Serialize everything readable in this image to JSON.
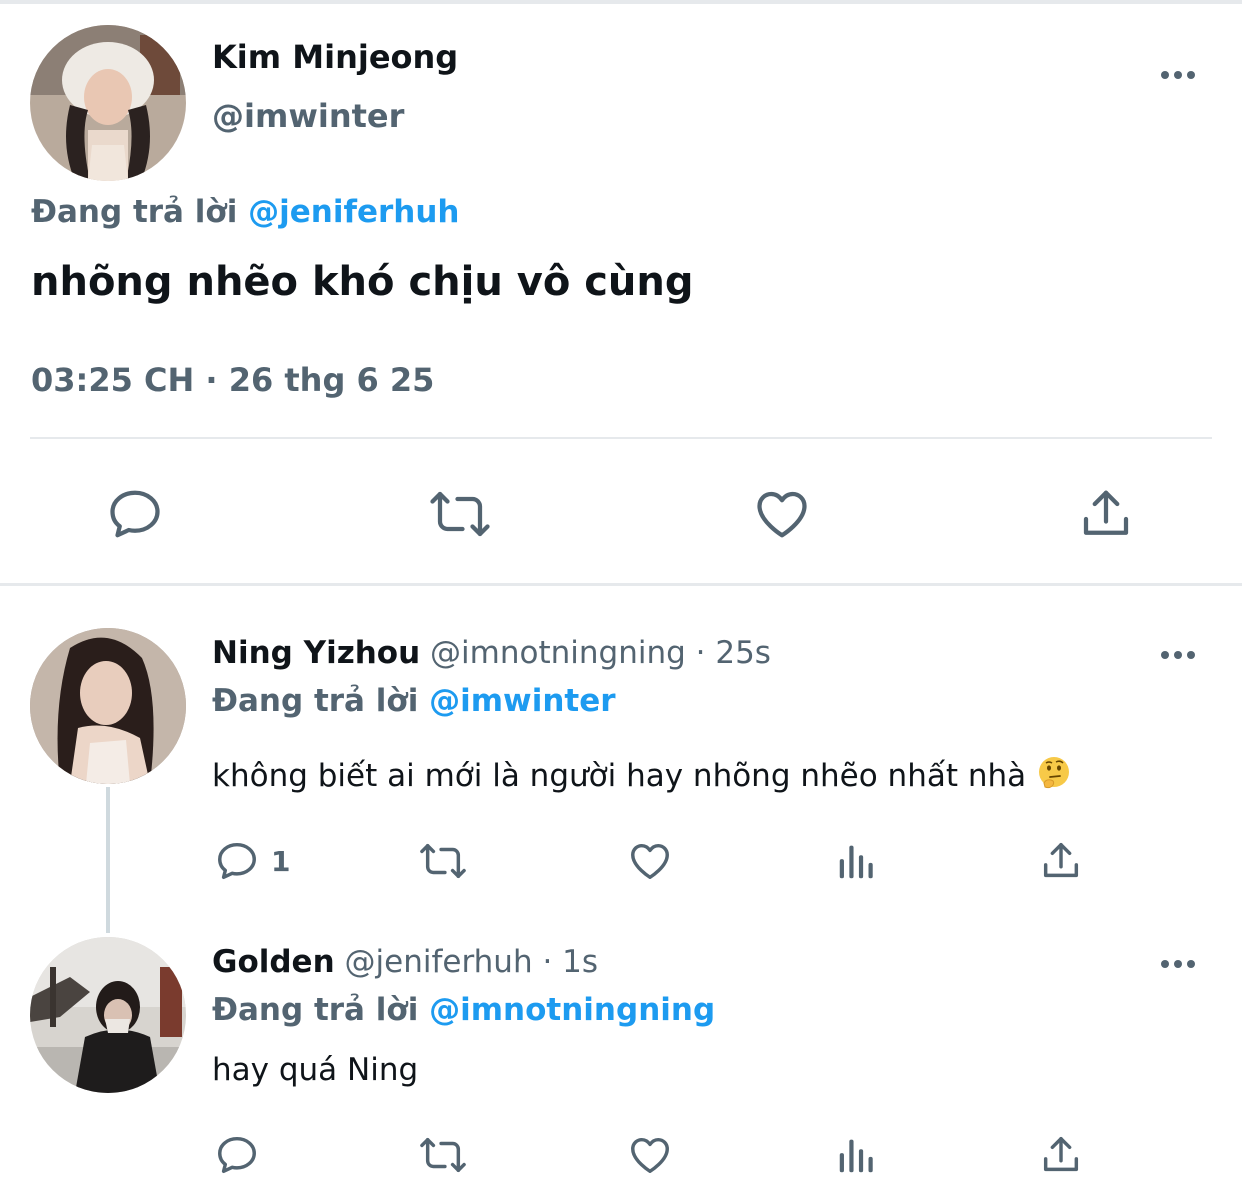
{
  "main_tweet": {
    "name": "Kim Minjeong",
    "handle": "@imwinter",
    "reply_prefix": "Đang trả lời",
    "reply_to": "@jeniferhuh",
    "text": "nhõng nhẽo khó chịu vô cùng",
    "timestamp": "03:25 CH · 26 thg 6 25",
    "actions": [
      "reply-icon",
      "retweet-icon",
      "like-icon",
      "share-icon"
    ]
  },
  "replies": [
    {
      "name": "Ning Yizhou",
      "handle": "@imnotningning",
      "time": "· 25s",
      "reply_prefix": "Đang trả lời",
      "reply_to": "@imwinter",
      "text": "không biết ai mới là người hay nhõng nhẽo nhất nhà",
      "emoji": "thinking-face",
      "reply_count": "1"
    },
    {
      "name": "Golden",
      "handle": "@jeniferhuh",
      "time": "· 1s",
      "reply_prefix": "Đang trả lời",
      "reply_to": "@imnotningning",
      "text": "hay quá Ning",
      "reply_count": ""
    }
  ],
  "colors": {
    "text": "#0f1419",
    "secondary": "#536471",
    "accent": "#1d9bf0",
    "divider": "#e6e9ec"
  }
}
